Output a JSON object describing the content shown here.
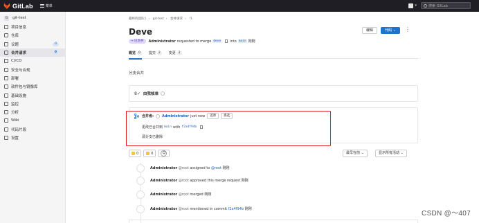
{
  "topbar": {
    "brand": "GitLab",
    "menu_label": "菜单",
    "search_placeholder": "搜索 GitLab"
  },
  "sidebar": {
    "project_initial": "G",
    "project_name": "git-test",
    "items": [
      {
        "label": "项目信息",
        "icon": "info-icon",
        "count": null,
        "active": false
      },
      {
        "label": "仓库",
        "icon": "repository-icon",
        "count": null,
        "active": false
      },
      {
        "label": "议题",
        "icon": "issues-icon",
        "count": "0",
        "active": false
      },
      {
        "label": "合并请求",
        "icon": "merge-request-icon",
        "count": "0",
        "active": true
      },
      {
        "label": "CI/CD",
        "icon": "rocket-icon",
        "count": null,
        "active": false
      },
      {
        "label": "安全与合规",
        "icon": "shield-icon",
        "count": null,
        "active": false
      },
      {
        "label": "部署",
        "icon": "deploy-icon",
        "count": null,
        "active": false
      },
      {
        "label": "软件包与镜像库",
        "icon": "package-icon",
        "count": null,
        "active": false
      },
      {
        "label": "基础设施",
        "icon": "cloud-icon",
        "count": null,
        "active": false
      },
      {
        "label": "监控",
        "icon": "monitor-icon",
        "count": null,
        "active": false
      },
      {
        "label": "分析",
        "icon": "chart-icon",
        "count": null,
        "active": false
      },
      {
        "label": "Wiki",
        "icon": "book-icon",
        "count": null,
        "active": false
      },
      {
        "label": "代码片段",
        "icon": "snippet-icon",
        "count": null,
        "active": false
      },
      {
        "label": "设置",
        "icon": "gear-icon",
        "count": null,
        "active": false
      }
    ]
  },
  "breadcrumb": [
    "最终的团队1",
    "git-test",
    "合并请求",
    "!1"
  ],
  "mr": {
    "title": "Deve",
    "edit_label": "编辑",
    "code_label": "代码 ⌄",
    "status_badge": "已合并",
    "author": "Administrator",
    "requested_text": "requested to merge",
    "source_branch": "deve",
    "into_text": "into",
    "target_branch": "main",
    "time": "刚刚"
  },
  "tabs": [
    {
      "label": "概览",
      "count": "0",
      "active": true
    },
    {
      "label": "提交",
      "count": "2",
      "active": false
    },
    {
      "label": "变更",
      "count": "2",
      "active": false
    }
  ],
  "description": "分支合并",
  "approval": {
    "label": "由我核准"
  },
  "merge_widget": {
    "merged_by_label": "合并者:",
    "author": "Administrator",
    "time": "just now",
    "revert_label": "还原",
    "cherry_pick_label": "拣选",
    "changes_merged_prefix": "更改已合并到",
    "target_branch": "main",
    "with_text": "with",
    "commit_sha": "f2a4f94b",
    "branch_deleted": "源分支已删除"
  },
  "reactions": {
    "thumbs_up": "0",
    "thumbs_down": "0",
    "smile": "☺",
    "sort_label": "最早在前 ⌄",
    "filter_label": "显示所有活动 ⌄"
  },
  "timeline": [
    {
      "icon": "user-icon",
      "author": "Administrator",
      "user": "@root",
      "action": "assigned to",
      "target": "@root",
      "time": "刚刚",
      "sha": ""
    },
    {
      "icon": "approve-icon",
      "author": "Administrator",
      "user": "@root",
      "action": "approved this merge request",
      "target": "",
      "time": "刚刚",
      "sha": ""
    },
    {
      "icon": "merge-icon",
      "author": "Administrator",
      "user": "@root",
      "action": "merged",
      "target": "",
      "time": "刚刚",
      "sha": ""
    },
    {
      "icon": "comment-icon",
      "author": "Administrator",
      "user": "@root",
      "action": "mentioned in commit",
      "target": "",
      "time": "刚刚",
      "sha": "f2a4f94b"
    }
  ],
  "watermark": "CSDN @～407",
  "colors": {
    "topbar": "#1f1e24",
    "accent": "#1f75cb",
    "highlight": "#e0242b",
    "merged_badge": "#5943b6"
  }
}
